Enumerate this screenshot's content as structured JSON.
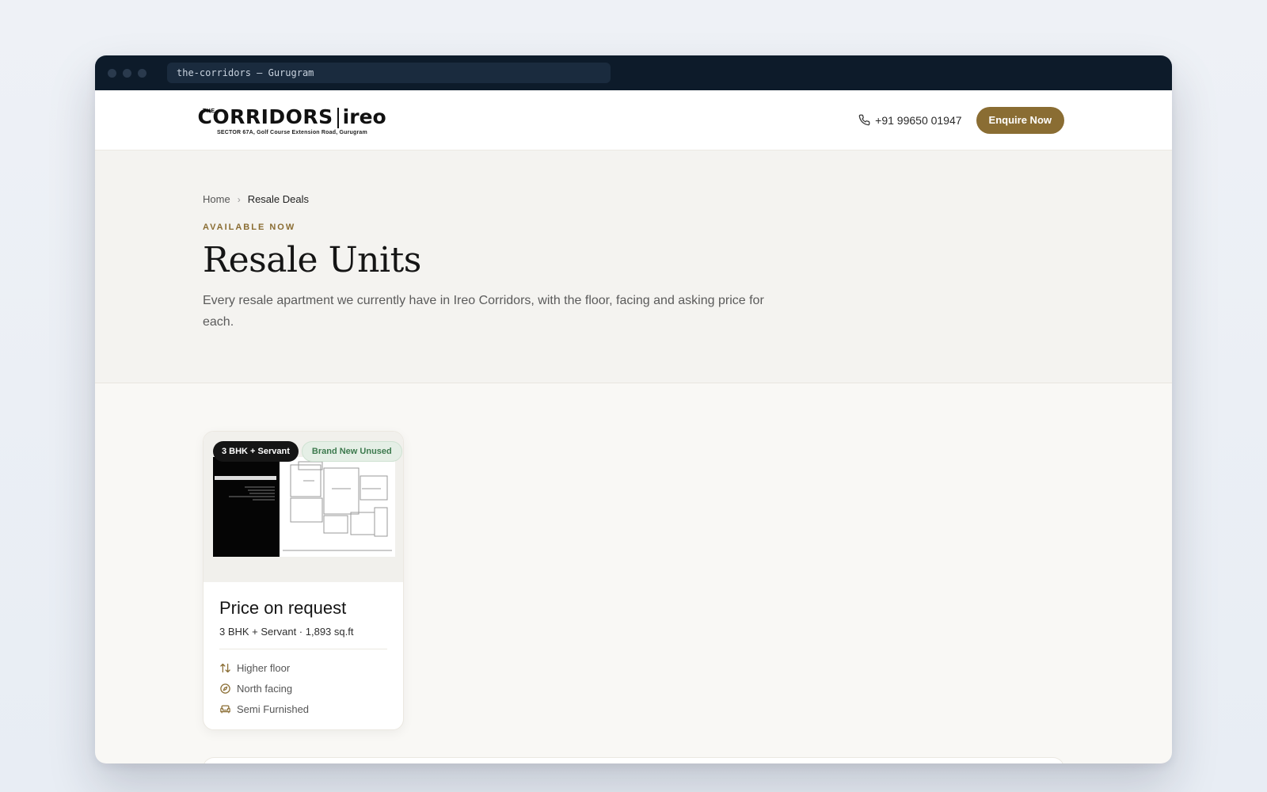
{
  "window": {
    "url": "the-corridors — Gurugram"
  },
  "header": {
    "logo_the": "THE",
    "logo_main": "CORRIDORS",
    "logo_brand": "ireo",
    "logo_sub": "SECTOR 67A, Golf Course Extension Road, Gurugram",
    "phone": "+91 99650 01947",
    "cta_label": "Enquire Now"
  },
  "hero": {
    "breadcrumb": {
      "home": "Home",
      "current": "Resale Deals"
    },
    "eyebrow": "AVAILABLE NOW",
    "title": "Resale Units",
    "description": "Every resale apartment we currently have in Ireo Corridors, with the floor, facing and asking price for each."
  },
  "listings": [
    {
      "type_badge": "3 BHK + Servant",
      "condition_badge": "Brand New Unused",
      "price": "Price on request",
      "specs": "3 BHK + Servant · 1,893 sq.ft",
      "floor": "Higher floor",
      "facing": "North facing",
      "furnishing": "Semi Furnished"
    }
  ],
  "colors": {
    "accent": "#8a6d33",
    "titlebar": "#0d1b2a",
    "badge_green_bg": "#e5efe6",
    "badge_green_text": "#3d7a4e"
  }
}
